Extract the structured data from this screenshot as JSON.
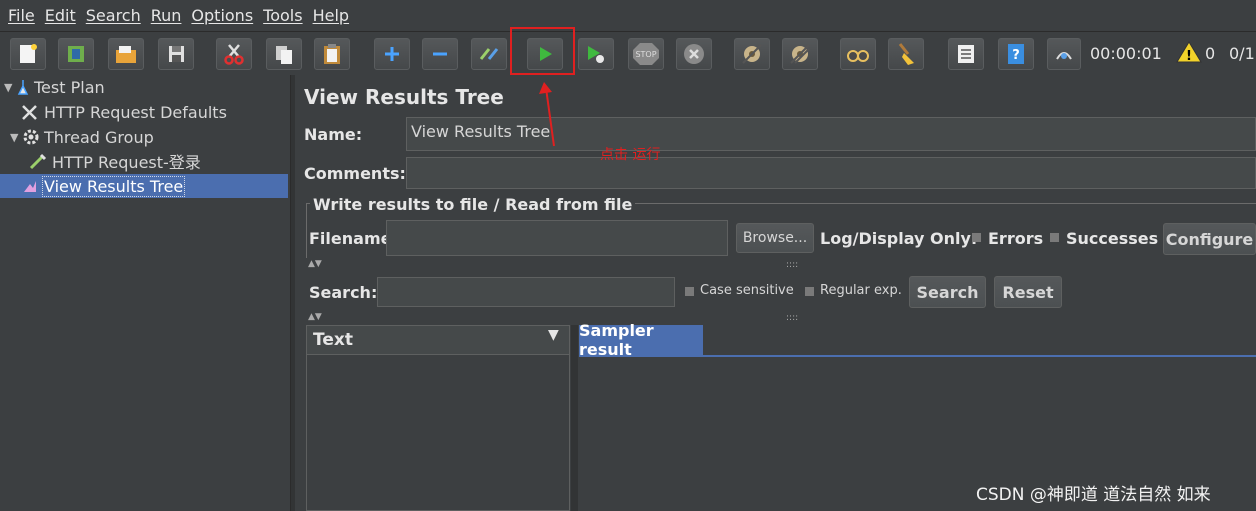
{
  "menu": [
    "File",
    "Edit",
    "Search",
    "Run",
    "Options",
    "Tools",
    "Help"
  ],
  "toolbar": {
    "buttons": [
      "new",
      "templates",
      "open",
      "save",
      "cut",
      "copy",
      "paste",
      "expand",
      "collapse",
      "toggle",
      "start",
      "start-no-pause",
      "stop",
      "shutdown",
      "clear",
      "clear-all",
      "search",
      "reset-search",
      "function-helper",
      "help",
      "log-viewer"
    ],
    "timer": "00:00:01",
    "warning_count": "0",
    "thread_ratio": "0/1"
  },
  "tree": {
    "items": [
      {
        "label": "Test Plan",
        "icon": "test-plan-icon"
      },
      {
        "label": "HTTP Request Defaults",
        "icon": "wrench-icon"
      },
      {
        "label": "Thread Group",
        "icon": "gear-icon"
      },
      {
        "label": "HTTP Request-登录",
        "icon": "pipette-icon"
      },
      {
        "label": "View Results Tree",
        "icon": "chart-icon",
        "selected": true
      }
    ]
  },
  "panel": {
    "title": "View Results Tree",
    "name_label": "Name:",
    "name_value": "View Results Tree",
    "comments_label": "Comments:",
    "comments_value": "",
    "group_title": "Write results to file / Read from file",
    "filename_label": "Filename",
    "filename_value": "",
    "browse_label": "Browse...",
    "log_display_label": "Log/Display Only:",
    "errors_label": "Errors",
    "successes_label": "Successes",
    "configure_label": "Configure",
    "search_label": "Search:",
    "search_value": "",
    "case_sensitive_label": "Case sensitive",
    "regular_exp_label": "Regular exp.",
    "search_button": "Search",
    "reset_button": "Reset",
    "text_header": "Text",
    "sampler_tab": "Sampler result"
  },
  "annotation": {
    "text": "点击 运行"
  },
  "watermark": "CSDN @神即道 道法自然 如来",
  "colors": {
    "background": "#3c3f41",
    "selection": "#4b6eaf",
    "annotation": "#e02020",
    "start_green": "#3fb93f"
  }
}
